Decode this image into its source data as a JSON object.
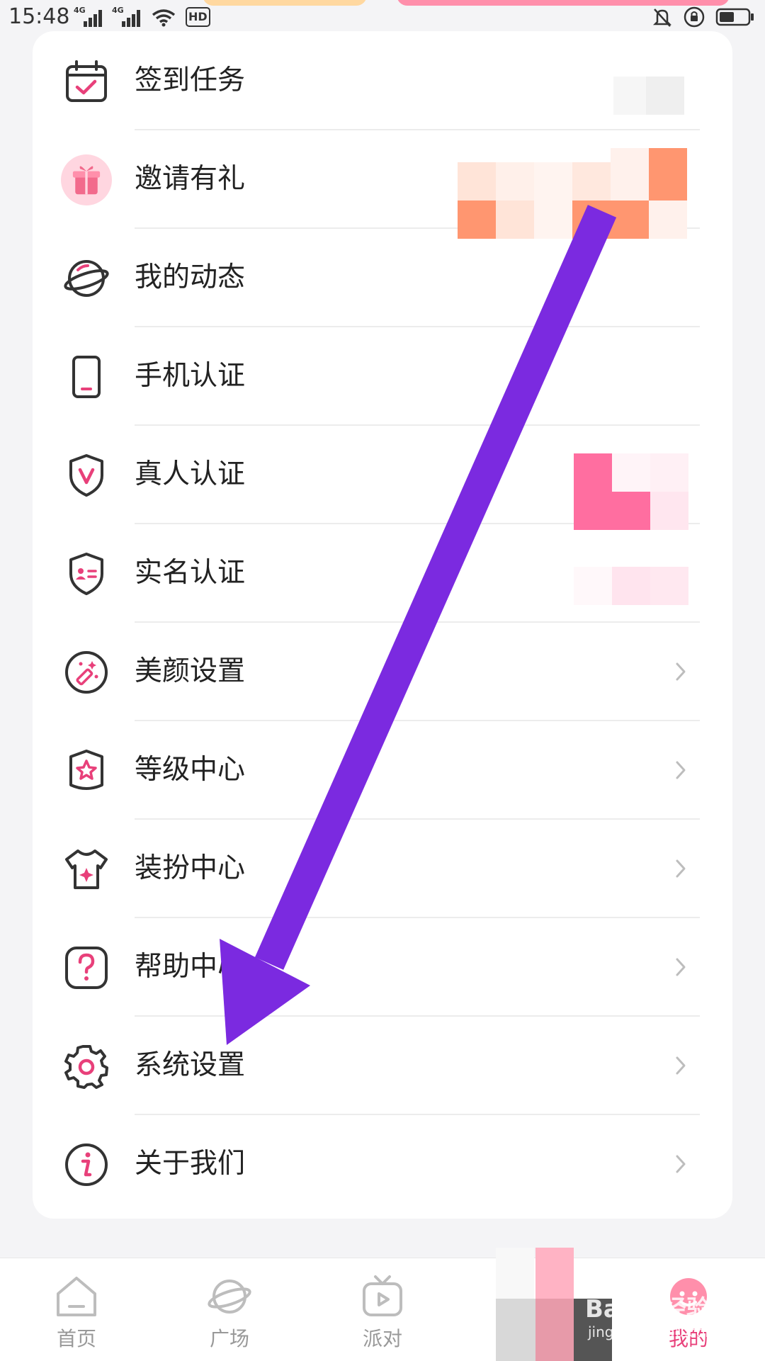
{
  "status_bar": {
    "time": "15:48",
    "network": "4G",
    "hd_label": "HD",
    "icons": [
      "signal-icon",
      "signal-icon",
      "wifi-icon",
      "hd-icon",
      "mute-icon",
      "rotation-lock-icon",
      "battery-icon"
    ]
  },
  "menu": {
    "items": [
      {
        "label": "签到任务",
        "icon": "calendar-check-icon",
        "has_chevron": false
      },
      {
        "label": "邀请有礼",
        "icon": "gift-icon",
        "has_chevron": false
      },
      {
        "label": "我的动态",
        "icon": "planet-icon",
        "has_chevron": false
      },
      {
        "label": "手机认证",
        "icon": "phone-icon",
        "has_chevron": false
      },
      {
        "label": "真人认证",
        "icon": "shield-v-icon",
        "has_chevron": false
      },
      {
        "label": "实名认证",
        "icon": "id-shield-icon",
        "has_chevron": false
      },
      {
        "label": "美颜设置",
        "icon": "magic-wand-icon",
        "has_chevron": true
      },
      {
        "label": "等级中心",
        "icon": "badge-star-icon",
        "has_chevron": true
      },
      {
        "label": "装扮中心",
        "icon": "tshirt-icon",
        "has_chevron": true
      },
      {
        "label": "帮助中心",
        "icon": "help-icon",
        "has_chevron": true
      },
      {
        "label": "系统设置",
        "icon": "gear-icon",
        "has_chevron": true
      },
      {
        "label": "关于我们",
        "icon": "info-icon",
        "has_chevron": true
      }
    ]
  },
  "bottom_nav": {
    "tabs": [
      {
        "label": "首页",
        "icon": "home-icon",
        "active": false
      },
      {
        "label": "广场",
        "icon": "planet-icon",
        "active": false
      },
      {
        "label": "派对",
        "icon": "tv-play-icon",
        "active": false
      },
      {
        "label": "我的",
        "icon": "smile-icon",
        "active": true
      }
    ]
  },
  "colors": {
    "accent": "#e8407a",
    "annotation_arrow": "#7b2ae0",
    "icon_stroke": "#333333"
  },
  "watermark": {
    "text": "Baidu经验",
    "sub": "jingyan.baidu.com"
  }
}
